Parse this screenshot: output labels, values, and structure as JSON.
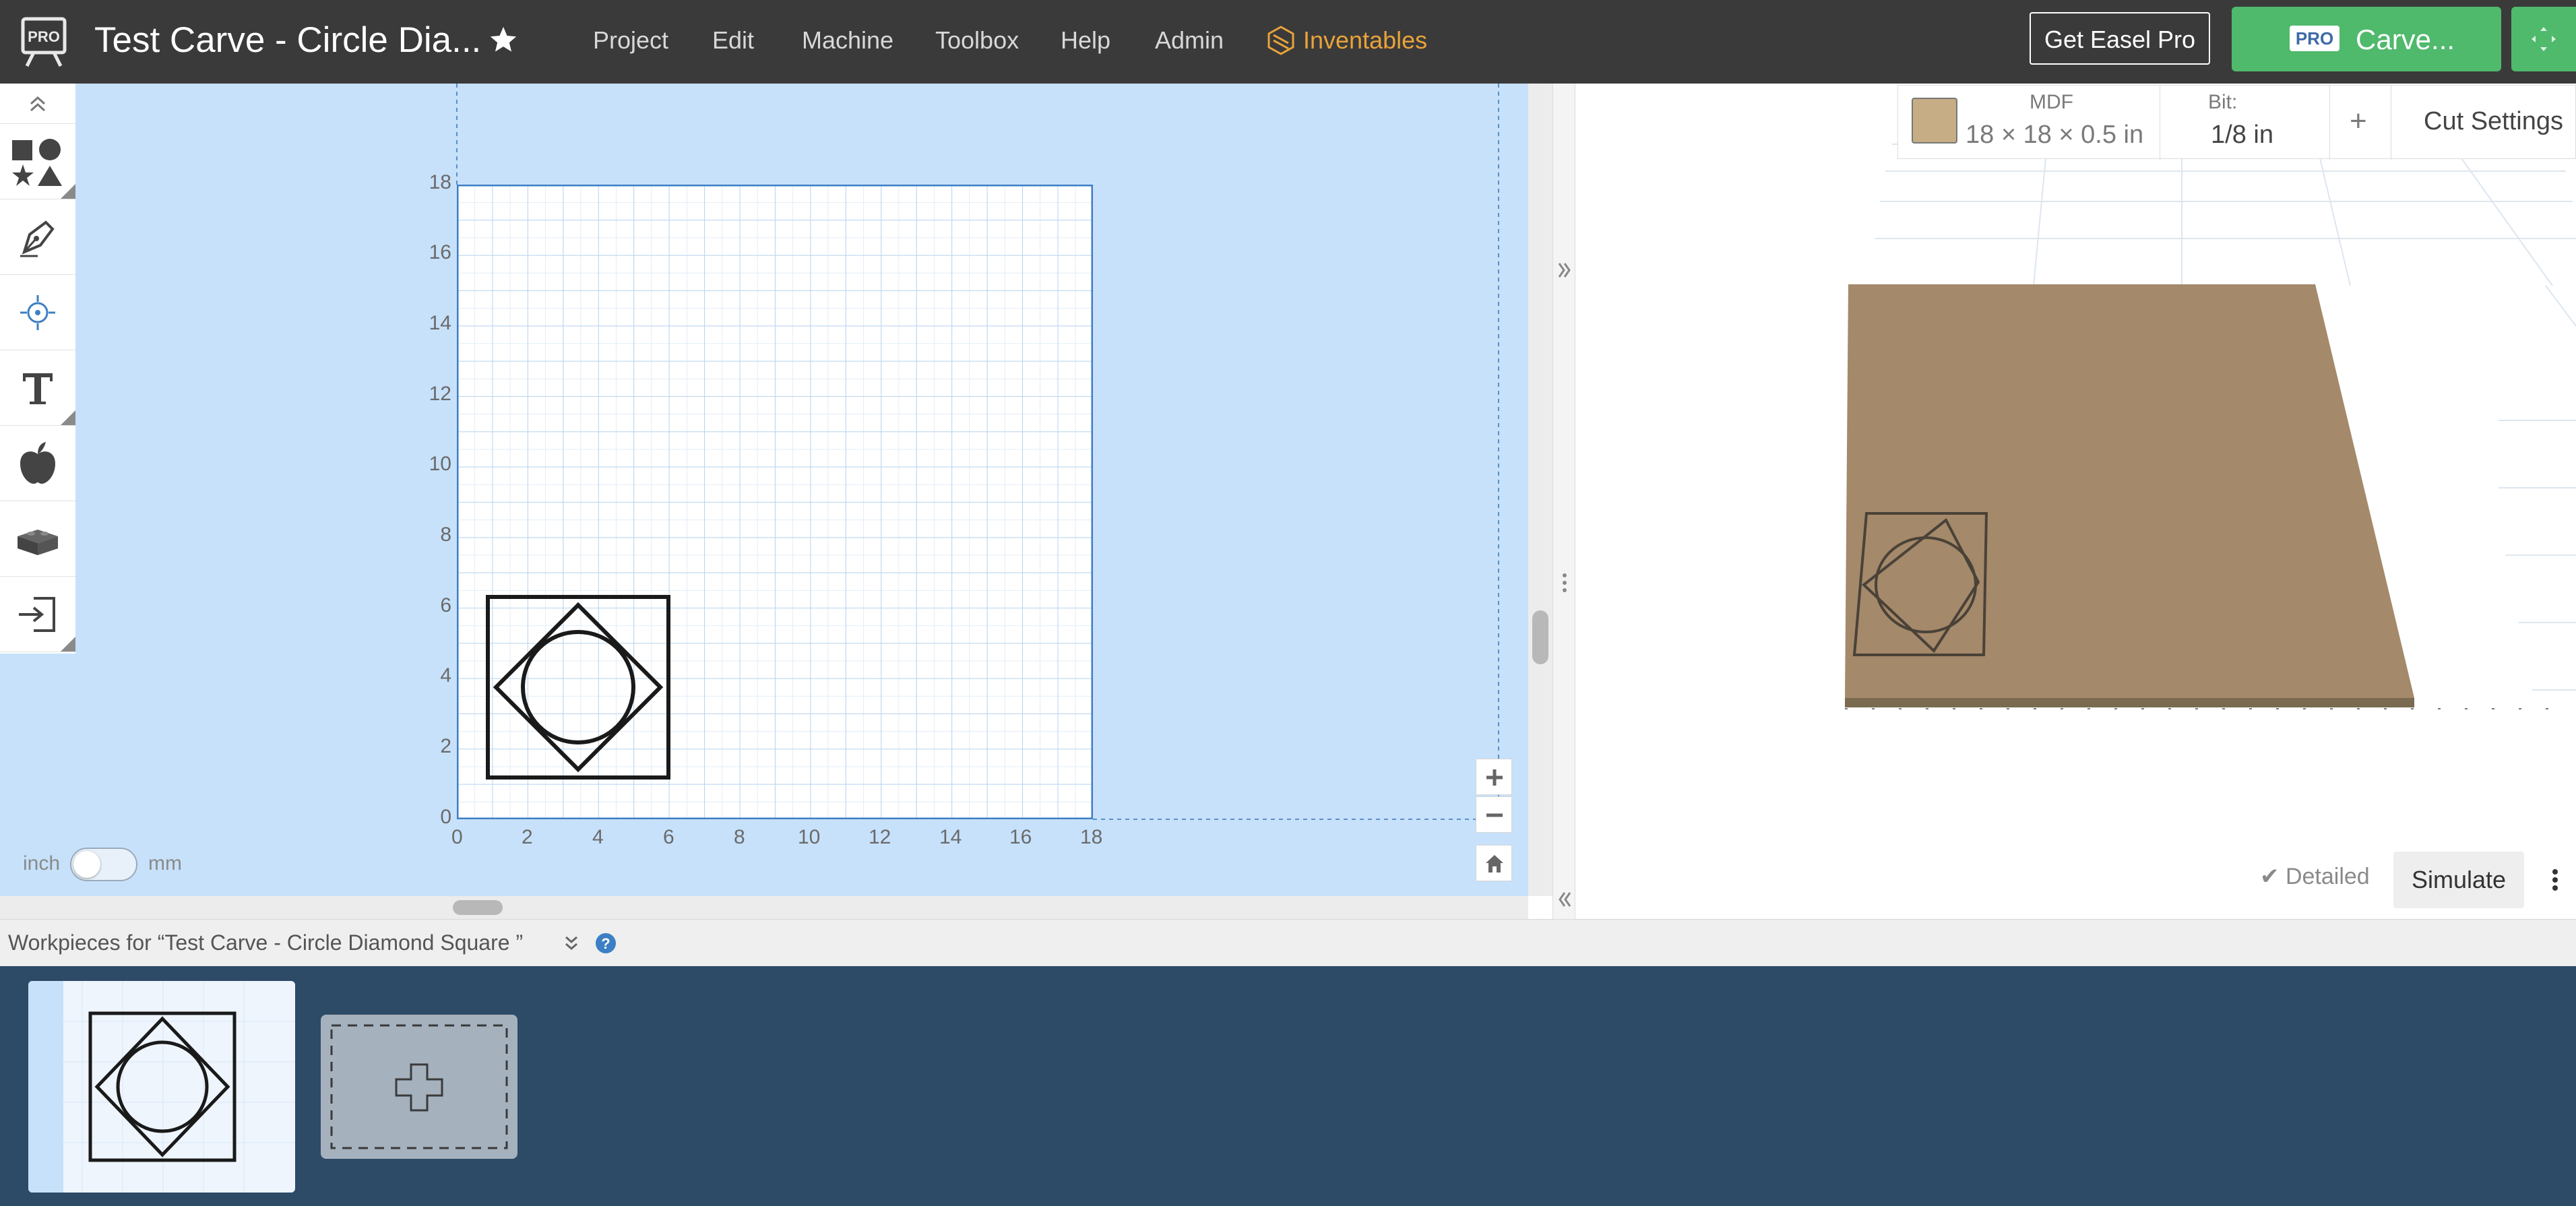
{
  "app": {
    "badge": "PRO",
    "title": "Test Carve - Circle Dia...",
    "menu": [
      "Project",
      "Edit",
      "Machine",
      "Toolbox",
      "Help",
      "Admin"
    ],
    "inventables": "Inventables",
    "get_pro": "Get Easel Pro",
    "carve_badge": "PRO",
    "carve": "Carve..."
  },
  "material": {
    "name": "MDF",
    "dimensions": "18 × 18 × 0.5 in",
    "bit_label": "Bit:",
    "bit_value": "1/8 in",
    "add": "+",
    "cut_settings": "Cut Settings",
    "color": "#c7ad86"
  },
  "canvas": {
    "x_ticks": [
      "0",
      "2",
      "4",
      "6",
      "8",
      "10",
      "12",
      "14",
      "16",
      "18"
    ],
    "y_ticks": [
      "18",
      "16",
      "14",
      "12",
      "10",
      "8",
      "6",
      "4",
      "2",
      "0"
    ],
    "units_left": "inch",
    "units_right": "mm"
  },
  "preview": {
    "detailed": "Detailed",
    "simulate": "Simulate"
  },
  "workpieces": {
    "label": "Workpieces for “Test Carve - Circle Diamond Square ”"
  },
  "colors": {
    "topbar": "#3a3a3a",
    "accent_green": "#4fb96c",
    "canvas_bg": "#c7e1fa",
    "tray_bg": "#2d4a66",
    "inventables": "#e8a33a"
  }
}
